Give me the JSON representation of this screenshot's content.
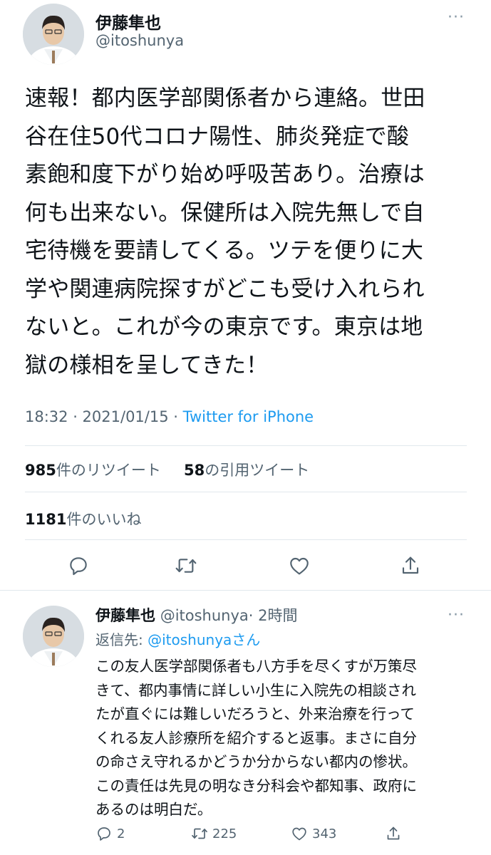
{
  "tweet": {
    "author_name": "伊藤隼也",
    "author_handle": "@itoshunya",
    "text_lines": [
      "速報！都内医学部関係者から連絡。世田",
      "谷在住50代コロナ陽性、肺炎発症で酸",
      "素飽和度下がり始め呼吸苦あり。治療は",
      "何も出来ない。保健所は入院先無しで自",
      "宅待機を要請してくる。ツテを便りに大",
      "学や関連病院探すがどこも受け入れられ",
      "ないと。これが今の東京です。東京は地",
      "獄の様相を呈してきた！"
    ],
    "timestamp": "18:32 · 2021/01/15 · ",
    "source": "Twitter for iPhone",
    "retweets_count": "985",
    "retweets_label": "件のリツイート",
    "quotes_count": "58",
    "quotes_label": "の引用ツイート",
    "likes_count": "1181",
    "likes_label": "件のいいね",
    "icons": [
      "reply-icon",
      "retweet-icon",
      "like-icon",
      "share-icon"
    ]
  },
  "reply": {
    "author_name": "伊藤隼也",
    "author_handle": "@itoshunya",
    "time": "· 2時間",
    "reply_to_prefix": "返信先: ",
    "reply_to_mention": "@itoshunya",
    "reply_to_suffix": "さん",
    "text_lines": [
      "この友人医学部関係者も八方手を尽くすが万策尽",
      "きて、都内事情に詳しい小生に入院先の相談され",
      "たが直ぐには難しいだろうと、外来治療を行って",
      "くれる友人診療所を紹介すると返事。まさに自分",
      "の命さえ守れるかどうか分からない都内の惨状。",
      "この責任は先見の明なき分科会や都知事、政府に",
      "あるのは明白だ。"
    ],
    "replies": "2",
    "retweets": "225",
    "likes": "343"
  },
  "colors": {
    "accent": "#1d9bf0",
    "secondary_text": "#536471",
    "divider": "#e1e8ed",
    "icon": "#536471"
  }
}
